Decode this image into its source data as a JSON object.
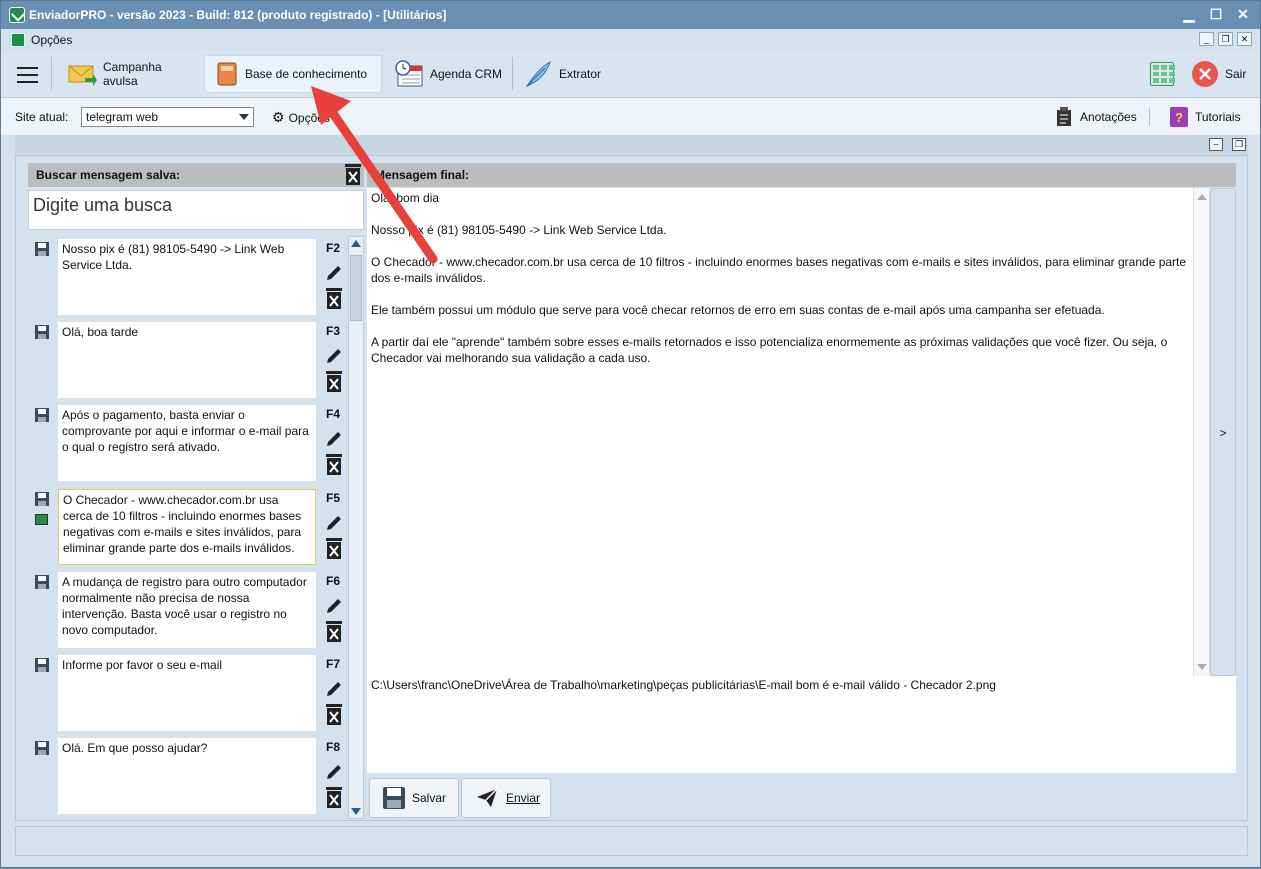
{
  "window": {
    "title": "EnviadorPRO - versão 2023 - Build: 812 (produto registrado) - [Utilitários]",
    "min": "▁",
    "max": "☐",
    "close": "✕"
  },
  "menu": {
    "label": "Opções"
  },
  "toolbar": {
    "campanha": "Campanha avulsa",
    "base": "Base de conhecimento",
    "agenda": "Agenda CRM",
    "extrator": "Extrator",
    "sair": "Sair"
  },
  "site": {
    "label": "Site atual:",
    "value": "telegram web",
    "opcoes": "Opções",
    "anotacoes": "Anotações",
    "tutoriais": "Tutoriais"
  },
  "left": {
    "header": "Buscar mensagem salva:",
    "search_placeholder": "Digite uma busca",
    "items": [
      {
        "key": "F2",
        "text": "Nosso pix é (81) 98105-5490 -> Link Web Service Ltda."
      },
      {
        "key": "F3",
        "text": "Olá, boa tarde"
      },
      {
        "key": "F4",
        "text": "Após o pagamento, basta enviar o comprovante por aqui e informar o e-mail para o qual o registro será ativado."
      },
      {
        "key": "F5",
        "text": "O Checador - www.checador.com.br usa cerca de 10 filtros - incluindo enormes bases negativas com e-mails e sites inválidos, para eliminar grande parte dos e-mails inválidos."
      },
      {
        "key": "F6",
        "text": "A mudança de registro para outro computador normalmente não precisa de nossa intervenção. Basta você usar o registro no novo computador."
      },
      {
        "key": "F7",
        "text": "Informe por favor o seu e-mail"
      },
      {
        "key": "F8",
        "text": "Olá. Em que posso ajudar?"
      }
    ]
  },
  "right": {
    "header": "Mensagem final:",
    "lines": [
      "Olá, bom dia",
      "Nosso pix é (81) 98105-5490 -> Link Web Service Ltda.",
      "O Checador - www.checador.com.br usa cerca de 10 filtros - incluindo enormes bases negativas com e-mails e sites inválidos, para eliminar grande parte dos e-mails inválidos.",
      "Ele também possui um módulo que serve para você checar retornos de erro em suas contas de e-mail após uma campanha ser efetuada.",
      "A partir daí ele \"aprende\" também sobre esses e-mails retornados e isso potencializa enormemente as próximas validações que você fizer. Ou seja, o Checador vai melhorando sua validação a cada uso."
    ],
    "side_arrow": ">",
    "attachment": "C:\\Users\\franc\\OneDrive\\Área de Trabalho\\marketing\\peças publicitárias\\E-mail bom é e-mail válido - Checador 2.png"
  },
  "buttons": {
    "salvar": "Salvar",
    "enviar": "Enviar"
  },
  "colors": {
    "titlebar": "#6b8fb2",
    "accent_red": "#e8403a"
  }
}
